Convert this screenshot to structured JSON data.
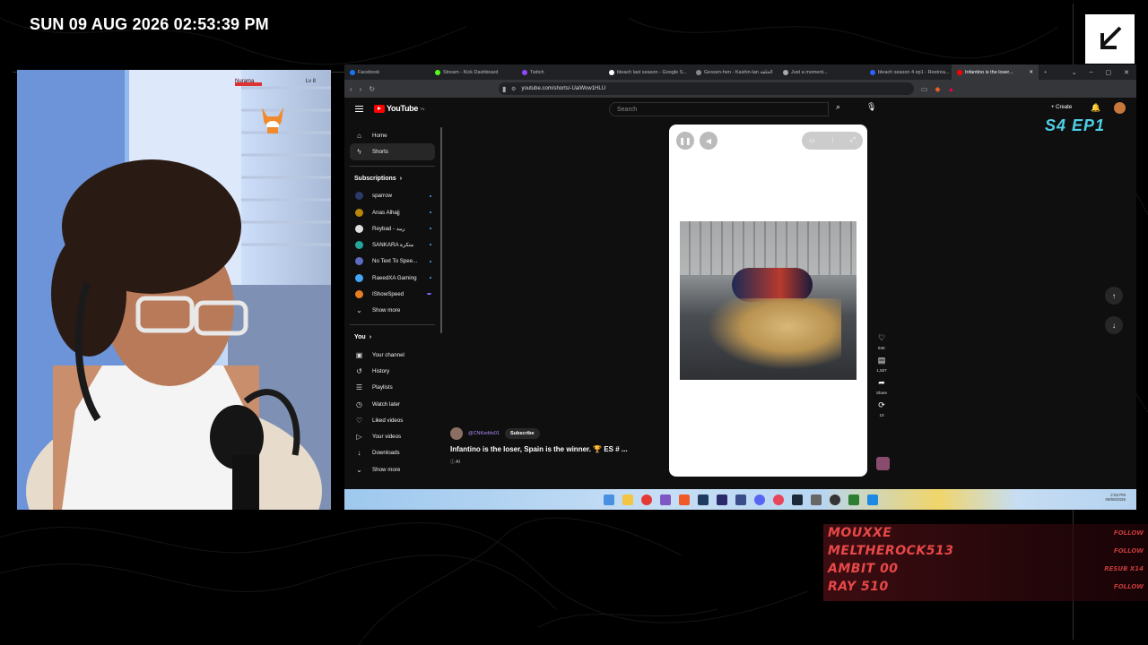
{
  "overlay": {
    "clock": "SUN 09 AUG 2026 02:53:39 PM",
    "episode_badge": "S4 EP1"
  },
  "game_hud": {
    "name": "Nurama",
    "level": "Lv 8"
  },
  "browser": {
    "tabs": [
      {
        "label": "Facebook",
        "color": "#1877f2"
      },
      {
        "label": "Stream - Kick Dashboard",
        "color": "#53fc18"
      },
      {
        "label": "Twitch",
        "color": "#9146ff"
      },
      {
        "label": "bleach last season - Google S...",
        "color": "#ffffff"
      },
      {
        "label": "Gessen-hen - Kashin-lan الحلقة",
        "color": "#888888"
      },
      {
        "label": "Just a moment...",
        "color": "#aaaaaa"
      },
      {
        "label": "bleach season 4 ep1 - Restrea...",
        "color": "#2962ff"
      },
      {
        "label": "Infantino is the loser...",
        "color": "#ff0000",
        "active": true
      }
    ],
    "url": "youtube.com/shorts/-UaiWow1HLU"
  },
  "youtube": {
    "logo": "YouTube",
    "country": "TN",
    "search_placeholder": "Search",
    "create_label": "+ Create",
    "nav": [
      {
        "icon": "⌂",
        "label": "Home"
      },
      {
        "icon": "ϟ",
        "label": "Shorts",
        "active": true
      }
    ],
    "subscriptions_header": "Subscriptions",
    "subscriptions": [
      {
        "label": "sparrow",
        "color": "#2b3a67"
      },
      {
        "label": "Anas Alhajj",
        "color": "#b8860b"
      },
      {
        "label": "Reybad - ريبد",
        "color": "#e0e0e0"
      },
      {
        "label": "SANKARA متكرة",
        "color": "#26a69a"
      },
      {
        "label": "No Text To Spee...",
        "color": "#5c6bc0"
      },
      {
        "label": "RaeedXA Gaming",
        "color": "#42a5f5"
      },
      {
        "label": "IShowSpeed",
        "color": "#e67e22"
      }
    ],
    "show_more": "Show more",
    "you_header": "You",
    "you_items": [
      {
        "icon": "▣",
        "label": "Your channel"
      },
      {
        "icon": "↺",
        "label": "History"
      },
      {
        "icon": "☰",
        "label": "Playlists"
      },
      {
        "icon": "◷",
        "label": "Watch later"
      },
      {
        "icon": "♡",
        "label": "Liked videos"
      },
      {
        "icon": "▷",
        "label": "Your videos"
      },
      {
        "icon": "↓",
        "label": "Downloads"
      }
    ],
    "short": {
      "channel_handle": "@CNKedits01",
      "subscribe_label": "Subscribe",
      "title": "Infantino is the loser, Spain is the winner. 🏆 ES # ...",
      "ai_label": "ⓘ AI",
      "actions": [
        {
          "icon": "♡",
          "label": "94K"
        },
        {
          "icon": "▤",
          "label": "1,507"
        },
        {
          "icon": "➦",
          "label": "Share"
        },
        {
          "icon": "⟳",
          "label": "10"
        }
      ]
    }
  },
  "taskbar": {
    "time": "2:53 PM",
    "date": "09/08/2026"
  },
  "follows": [
    {
      "name": "MOUXXE",
      "type": "FOLLOW"
    },
    {
      "name": "MELTHEROCK513",
      "type": "FOLLOW"
    },
    {
      "name": "AMBIT 00",
      "type": "RESUB X14"
    },
    {
      "name": "RAY 510",
      "type": "FOLLOW"
    }
  ]
}
